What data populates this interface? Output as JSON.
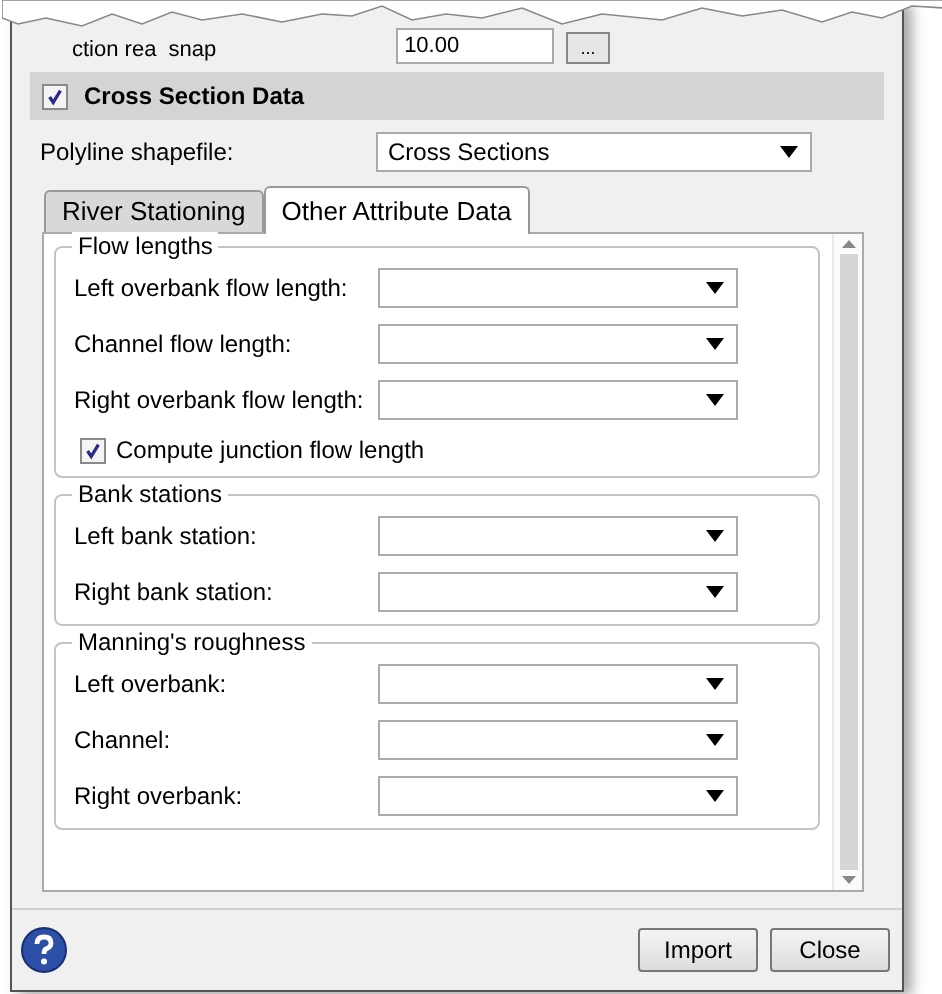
{
  "top_row": {
    "label_fragments": [
      "ction rea",
      "snap"
    ],
    "value": "10.00",
    "browse_button": "..."
  },
  "section": {
    "title": "Cross Section Data",
    "checked": true
  },
  "polyline": {
    "label": "Polyline shapefile:",
    "value": "Cross Sections"
  },
  "tabs": [
    {
      "label": "River Stationing",
      "selected": false
    },
    {
      "label": "Other Attribute Data",
      "selected": true
    }
  ],
  "groups": [
    {
      "title": "Flow lengths",
      "fields": [
        {
          "label": "Left overbank flow length:"
        },
        {
          "label": "Channel flow length:"
        },
        {
          "label": "Right overbank flow length:"
        }
      ],
      "checkbox": {
        "label": "Compute junction flow length",
        "checked": true
      }
    },
    {
      "title": "Bank stations",
      "fields": [
        {
          "label": "Left bank station:"
        },
        {
          "label": "Right bank station:"
        }
      ]
    },
    {
      "title": "Manning's roughness",
      "fields": [
        {
          "label": "Left overbank:"
        },
        {
          "label": "Channel:"
        },
        {
          "label": "Right overbank:"
        }
      ]
    }
  ],
  "buttons": [
    "Import",
    "Close"
  ]
}
